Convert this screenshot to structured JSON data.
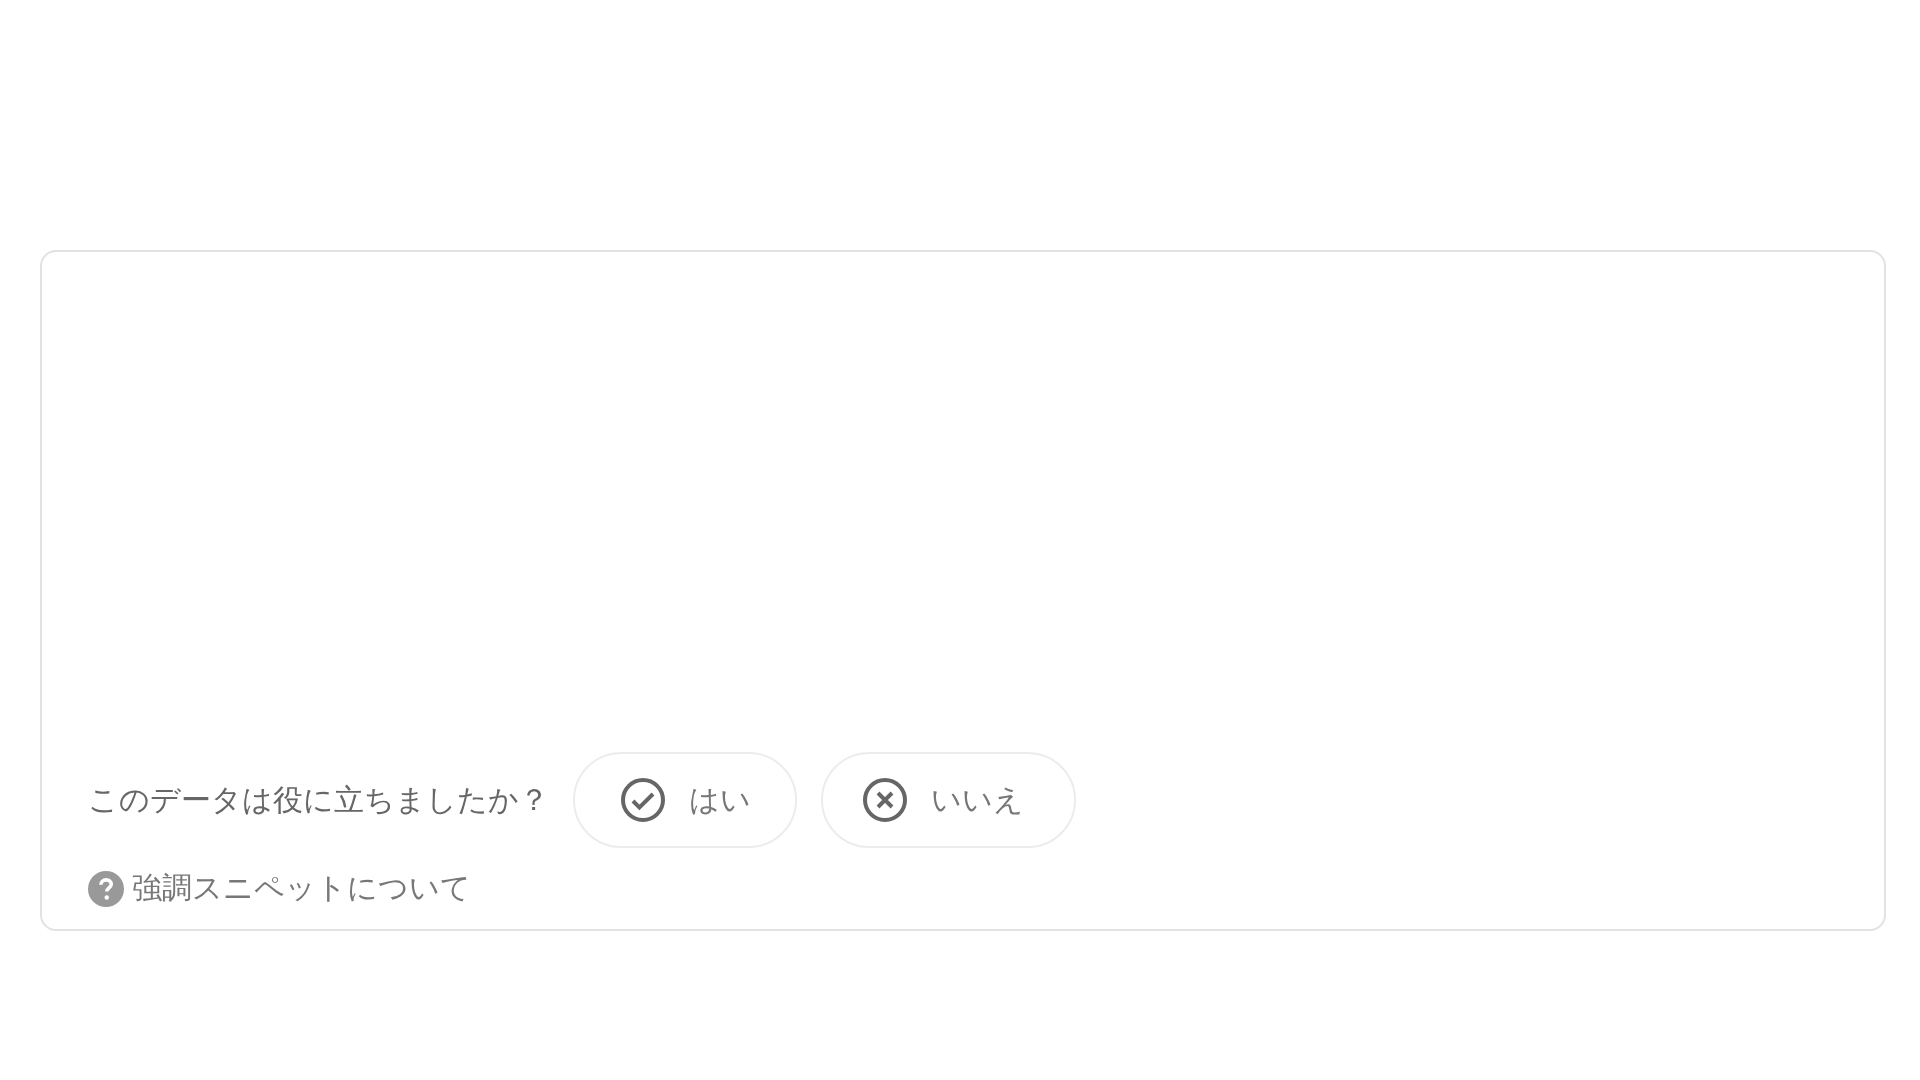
{
  "feedback": {
    "question": "このデータは役に立ちましたか？",
    "buttons": [
      {
        "label": "はい",
        "kind": "yes"
      },
      {
        "label": "いいえ",
        "kind": "no"
      }
    ]
  },
  "about_link": {
    "label": "強調スニペットについて"
  }
}
